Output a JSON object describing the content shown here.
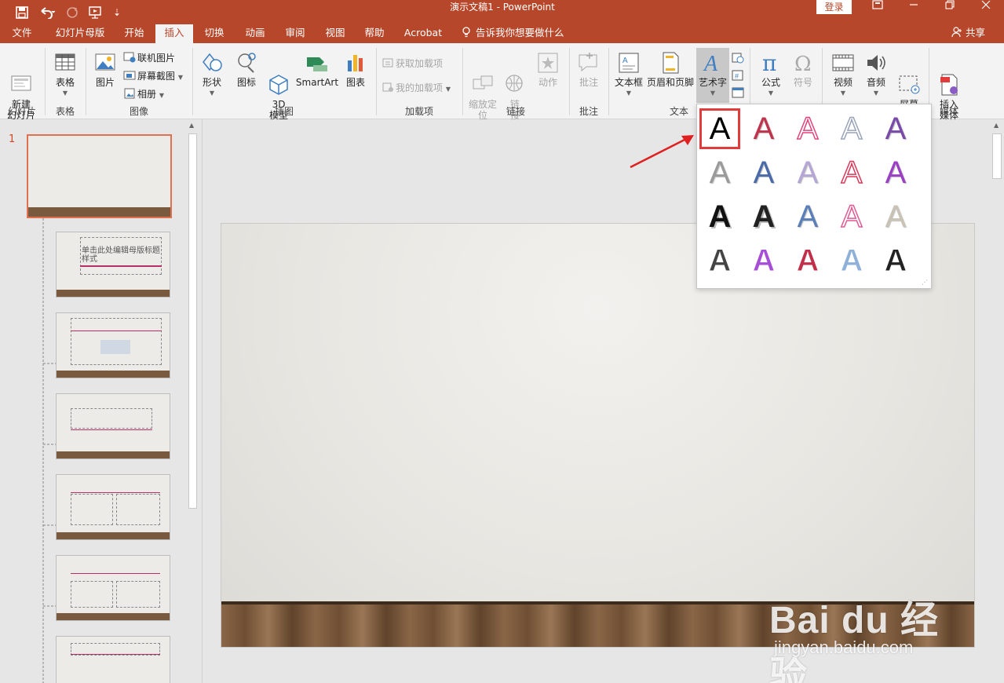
{
  "titlebar": {
    "title": "演示文稿1  -  PowerPoint",
    "login": "登录",
    "window_buttons": [
      "▣",
      "─",
      "❐",
      "✕"
    ]
  },
  "tabs": [
    "文件",
    "幻灯片母版",
    "开始",
    "插入",
    "切换",
    "动画",
    "审阅",
    "视图",
    "帮助",
    "Acrobat"
  ],
  "active_tab": "插入",
  "tell_me": "告诉我你想要做什么",
  "share": "共享",
  "ribbon": {
    "new_slide": "新建\n幻灯片",
    "table": "表格",
    "picture": "图片",
    "online_picture": "联机图片",
    "screenshot": "屏幕截图",
    "album": "相册",
    "shapes": "形状",
    "icons": "图标",
    "model3d": "3D\n模型",
    "smartart": "SmartArt",
    "chart": "图表",
    "get_addins": "获取加载项",
    "my_addins": "我的加载项",
    "zoom": "缩放定\n位",
    "link": "链\n接",
    "action": "动作",
    "comment": "批注",
    "textbox": "文本框",
    "header_footer": "页眉和页脚",
    "wordart": "艺术字",
    "equation": "公式",
    "symbol": "符号",
    "video": "视频",
    "audio": "音频",
    "screen_record": "屏幕\n录制",
    "insert_media": "插入\n媒体",
    "groups": {
      "slides": "幻灯片",
      "tables": "表格",
      "images": "图像",
      "illustrations": "插图",
      "addins": "加载项",
      "links": "链接",
      "comments": "批注",
      "text": "文本",
      "media": "媒体"
    }
  },
  "thumbnails": {
    "slide_number": "1",
    "layout1_title": "单击此处编辑母版标题样式"
  },
  "wordart_gallery": {
    "glyph": "A",
    "styles": [
      {
        "color": "#000000",
        "style": "plain"
      },
      {
        "color": "#c0334d",
        "style": "gradient"
      },
      {
        "color": "#e0457b",
        "style": "outline-pink"
      },
      {
        "color": "#9aa4b8",
        "style": "outline-grey"
      },
      {
        "color": "#7a4aa8",
        "style": "gradient-purple"
      },
      {
        "color": "#9a9a9a",
        "style": "plain-grey"
      },
      {
        "color": "#4a6aa8",
        "style": "blue-reflect"
      },
      {
        "color": "#b5a6d6",
        "style": "lavender"
      },
      {
        "color": "#d83a5a",
        "style": "outline-red"
      },
      {
        "color": "#9b3fc4",
        "style": "purple-gradient"
      },
      {
        "color": "#111111",
        "style": "shadow-black"
      },
      {
        "color": "#222222",
        "style": "shadow-dark"
      },
      {
        "color": "#5b7fb8",
        "style": "steel-blue"
      },
      {
        "color": "#e05a95",
        "style": "pink-outline"
      },
      {
        "color": "#c9c2b5",
        "style": "beige"
      },
      {
        "color": "#444444",
        "style": "hatched-black"
      },
      {
        "color": "#a64fd6",
        "style": "hatched-purple"
      },
      {
        "color": "#c0304a",
        "style": "hatched-red"
      },
      {
        "color": "#8fb0d8",
        "style": "hatched-blue"
      },
      {
        "color": "#222222",
        "style": "hatched-dark"
      }
    ]
  },
  "watermark": {
    "brand": "Bai du 经验",
    "url": "jingyan.baidu.com"
  }
}
